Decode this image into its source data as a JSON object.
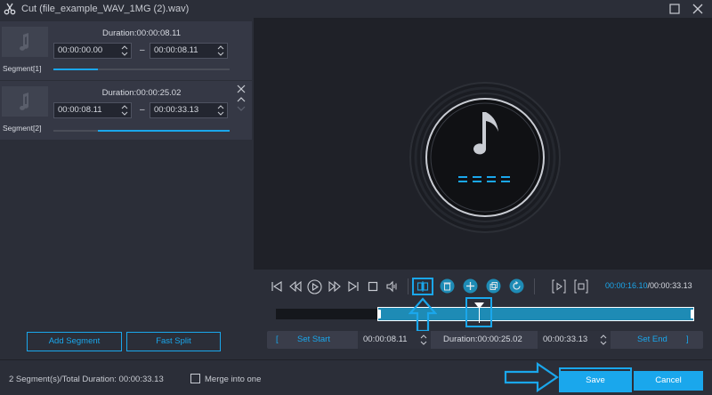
{
  "window": {
    "title": "Cut (file_example_WAV_1MG (2).wav)"
  },
  "segments": [
    {
      "label": "Segment[1]",
      "duration": "Duration:00:00:08.11",
      "start": "00:00:00.00",
      "end": "00:00:08.11",
      "fill_start": 0.0,
      "fill_end": 0.25
    },
    {
      "label": "Segment[2]",
      "duration": "Duration:00:00:25.02",
      "start": "00:00:08.11",
      "end": "00:00:33.13",
      "fill_start": 0.25,
      "fill_end": 1.0
    }
  ],
  "dash": "–",
  "left_buttons": {
    "add_segment": "Add Segment",
    "fast_split": "Fast Split"
  },
  "playback": {
    "current_time": "00:00:16.10",
    "total_time": "/00:00:33.13"
  },
  "set_row": {
    "open_bracket": "[",
    "set_start": "Set Start",
    "start_time": "00:00:08.11",
    "duration": "Duration:00:00:25.02",
    "end_time": "00:00:33.13",
    "set_end": "Set End",
    "close_bracket": "]"
  },
  "footer": {
    "summary": "2 Segment(s)/Total Duration: 00:00:33.13",
    "merge_label": "Merge into one",
    "save": "Save",
    "cancel": "Cancel"
  },
  "colors": {
    "accent": "#1aa7ec",
    "highlight": "#1aa7ec",
    "background": "#2b2e38",
    "preview_bg": "#1f2128"
  }
}
